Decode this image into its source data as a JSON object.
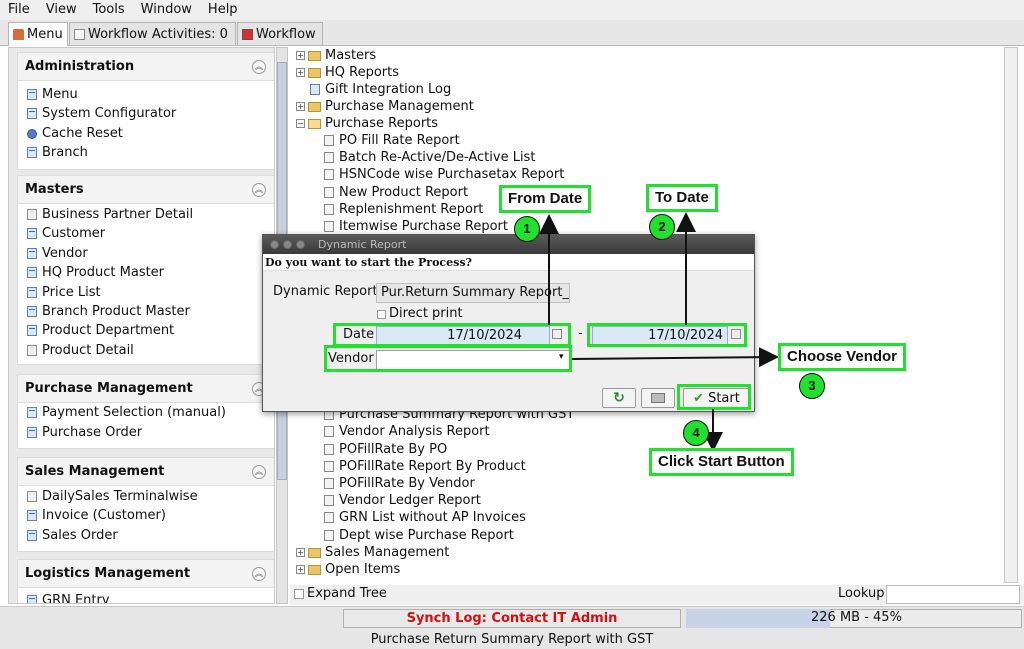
{
  "menubar": [
    "File",
    "View",
    "Tools",
    "Window",
    "Help"
  ],
  "tabs": {
    "menu": "Menu",
    "activities": "Workflow Activities: 0",
    "workflow": "Workflow"
  },
  "sidebar": {
    "administration": {
      "title": "Administration",
      "items": [
        "Menu",
        "System Configurator",
        "Cache Reset",
        "Branch"
      ]
    },
    "masters": {
      "title": "Masters",
      "items": [
        "Business Partner Detail",
        "Customer",
        "Vendor",
        "HQ Product Master",
        "Price List",
        "Branch Product Master",
        "Product Department",
        "Product Detail"
      ]
    },
    "purchase": {
      "title": "Purchase Management",
      "items": [
        "Payment Selection (manual)",
        "Purchase Order"
      ]
    },
    "sales": {
      "title": "Sales Management",
      "items": [
        "DailySales Terminalwise",
        "Invoice (Customer)",
        "Sales Order"
      ]
    },
    "logistics": {
      "title": "Logistics Management",
      "items": [
        "GRN Entry"
      ]
    }
  },
  "tree": {
    "top": [
      "Masters",
      "HQ Reports",
      "Gift Integration Log",
      "Purchase Management",
      "Purchase Reports"
    ],
    "children_top": [
      "PO Fill Rate Report",
      "Batch Re-Active/De-Active List",
      "HSNCode wise Purchasetax Report",
      "New Product Report",
      "Replenishment Report",
      "Itemwise Purchase Report"
    ],
    "children_bottom": [
      "Purchase Summary Report with GST",
      "Vendor Analysis Report",
      "POFillRate By PO",
      "POFillRate Report By Product",
      "POFillRate By Vendor",
      "Vendor Ledger Report",
      "GRN List without AP Invoices",
      "Dept wise Purchase Report"
    ],
    "bottom": [
      "Sales Management",
      "Open Items"
    ]
  },
  "bottombar": {
    "expand_tree": "Expand Tree",
    "lookup": "Lookup"
  },
  "status": {
    "sync": "Synch Log: Contact IT Admin",
    "memory": "226 MB - 45%",
    "memory_fraction": 0.45,
    "footer": "Purchase Return Summary Report with GST"
  },
  "dialog": {
    "title": "Dynamic Report",
    "question": "Do you want to start the Process?",
    "report_label": "Dynamic Report",
    "report_value": "Pur.Return Summary Report_G",
    "direct_print": "Direct print",
    "date_label": "Date",
    "date_from": "17/10/2024",
    "date_sep": "-",
    "date_to": "17/10/2024",
    "vendor_label": "Vendor",
    "vendor_value": "",
    "start": "Start"
  },
  "annotations": {
    "from_date": "From Date",
    "to_date": "To Date",
    "choose_vendor": "Choose Vendor",
    "click_start": "Click Start Button",
    "n1": "1",
    "n2": "2",
    "n3": "3",
    "n4": "4"
  },
  "colors": {
    "highlight": "#22e02e",
    "sync_text": "#d01010",
    "field_bg": "#dbe9f6"
  }
}
